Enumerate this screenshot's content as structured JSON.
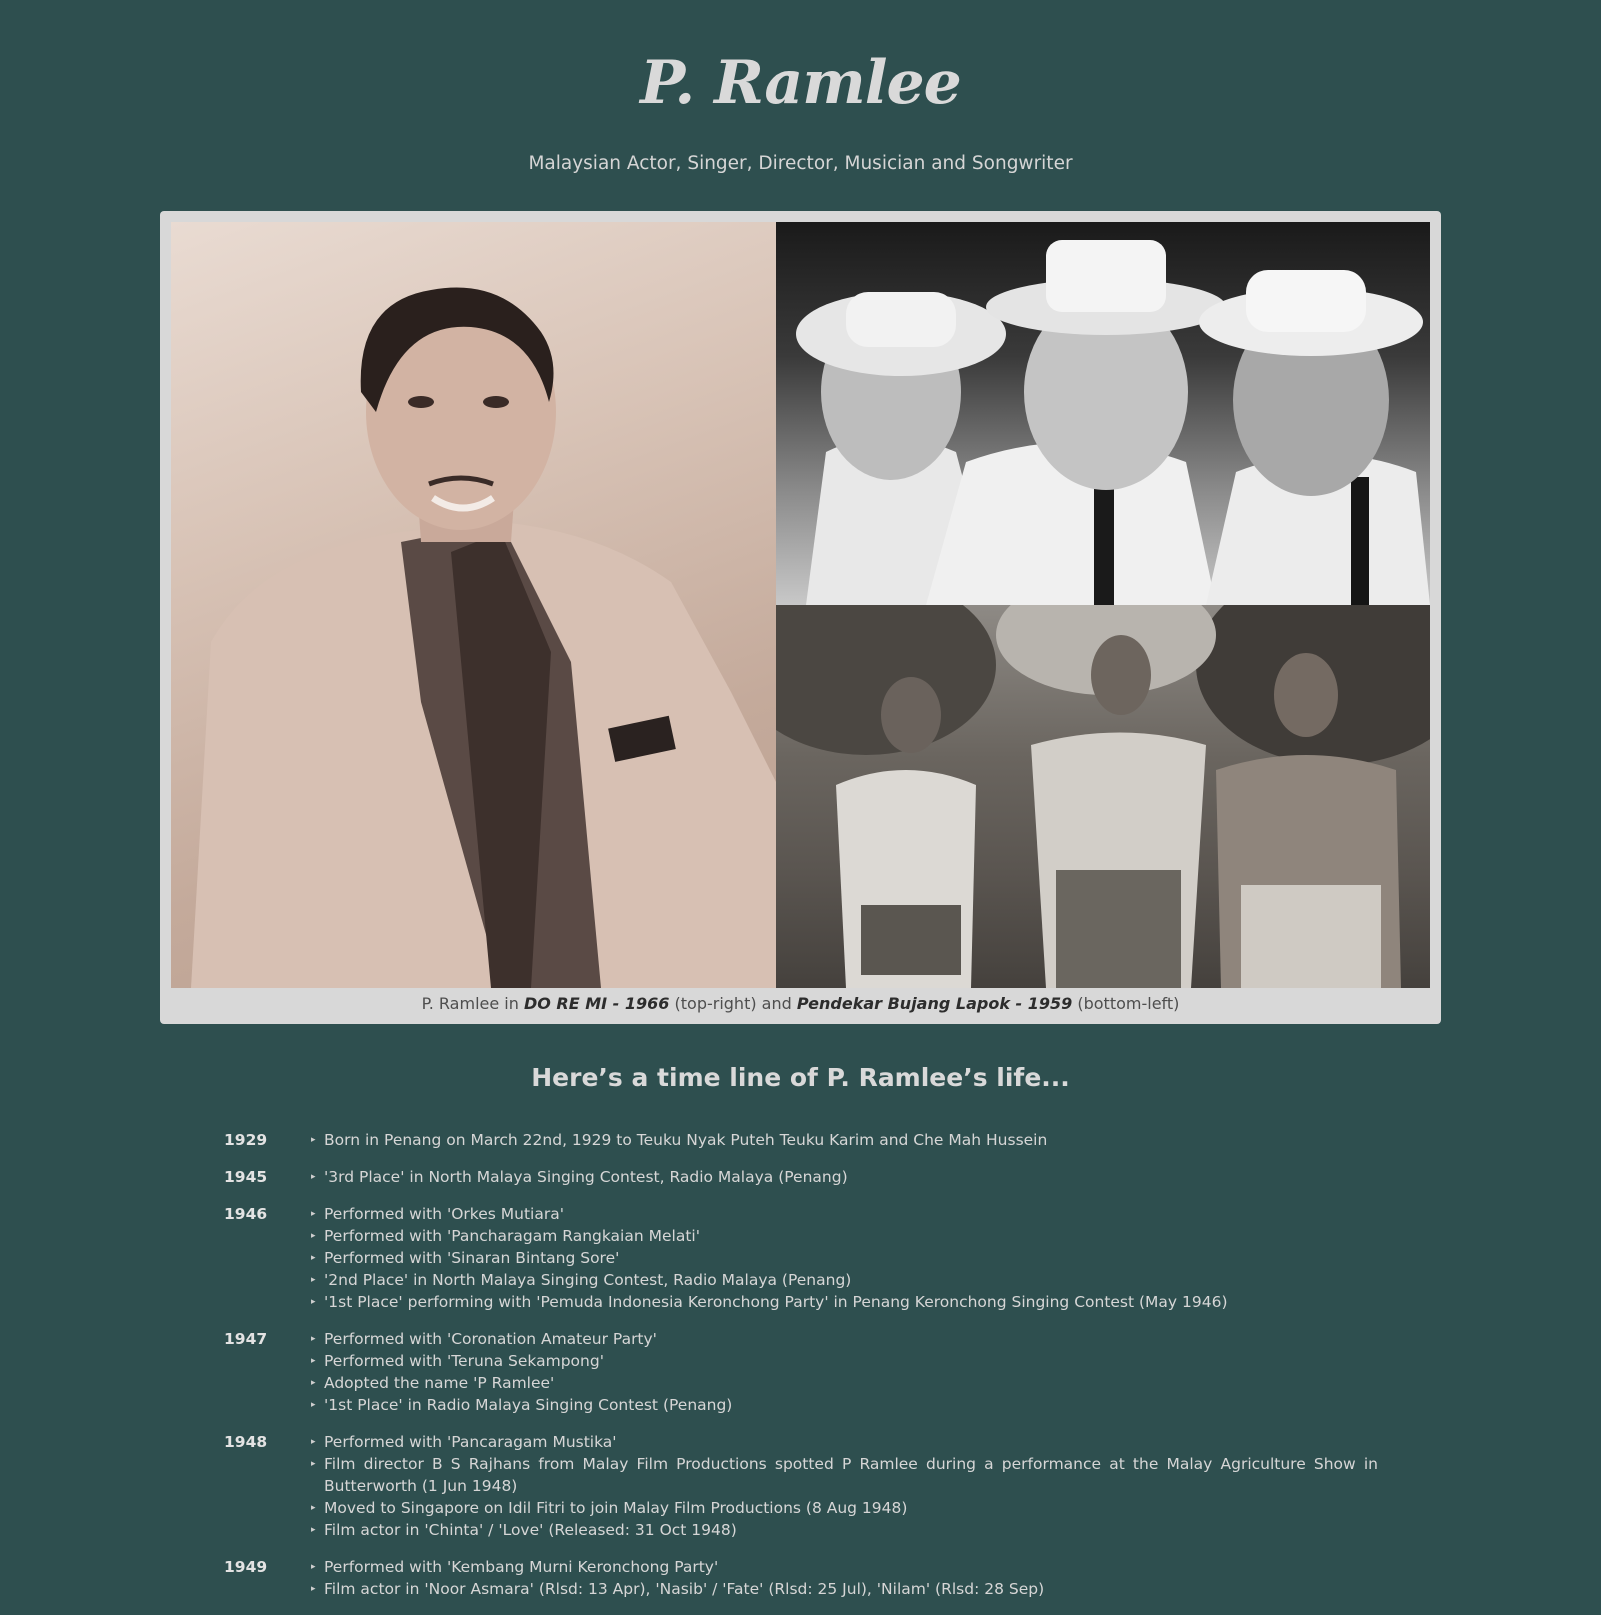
{
  "header": {
    "title": "P. Ramlee",
    "subtitle": "Malaysian Actor, Singer, Director, Musician and Songwriter"
  },
  "figure": {
    "images": [
      {
        "name": "portrait"
      },
      {
        "name": "do-re-mi-still"
      },
      {
        "name": "pendekar-bujang-lapok-still"
      }
    ],
    "caption": {
      "prefix": "P. Ramlee in ",
      "film1": "DO RE MI - 1966",
      "middle": " (top-right) and ",
      "film2": "Pendekar Bujang Lapok - 1959",
      "suffix": " (bottom-left)"
    }
  },
  "timeline": {
    "heading": "Here’s a time line of P. Ramlee’s life...",
    "years": [
      {
        "year": "1929",
        "events": [
          "Born in Penang on March 22nd, 1929 to Teuku Nyak Puteh Teuku Karim and Che Mah Hussein"
        ]
      },
      {
        "year": "1945",
        "events": [
          "'3rd Place' in North Malaya Singing Contest, Radio Malaya (Penang)"
        ]
      },
      {
        "year": "1946",
        "events": [
          "Performed with 'Orkes Mutiara'",
          "Performed with 'Pancharagam Rangkaian Melati'",
          "Performed with 'Sinaran Bintang Sore'",
          "'2nd Place' in North Malaya Singing Contest, Radio Malaya (Penang)",
          "'1st Place' performing with 'Pemuda Indonesia Keronchong Party' in Penang Keronchong Singing Contest (May 1946)"
        ]
      },
      {
        "year": "1947",
        "events": [
          "Performed with 'Coronation Amateur Party'",
          "Performed with 'Teruna Sekampong'",
          "Adopted the name 'P Ramlee'",
          "'1st Place' in Radio Malaya Singing Contest (Penang)"
        ]
      },
      {
        "year": "1948",
        "events": [
          "Performed with 'Pancaragam Mustika'",
          "Film director B S Rajhans from Malay Film Productions spotted P Ramlee during a performance at the Malay Agriculture Show in Butterworth (1 Jun 1948)",
          "Moved to Singapore on Idil Fitri to join Malay Film Productions (8 Aug 1948)",
          "Film actor in 'Chinta' / 'Love' (Released: 31 Oct 1948)"
        ]
      },
      {
        "year": "1949",
        "events": [
          "Performed with 'Kembang Murni Keronchong Party'",
          "Film actor in 'Noor Asmara' (Rlsd: 13 Apr), 'Nasib' / 'Fate' (Rlsd: 25 Jul), 'Nilam' (Rlsd: 28 Sep)"
        ]
      }
    ]
  }
}
